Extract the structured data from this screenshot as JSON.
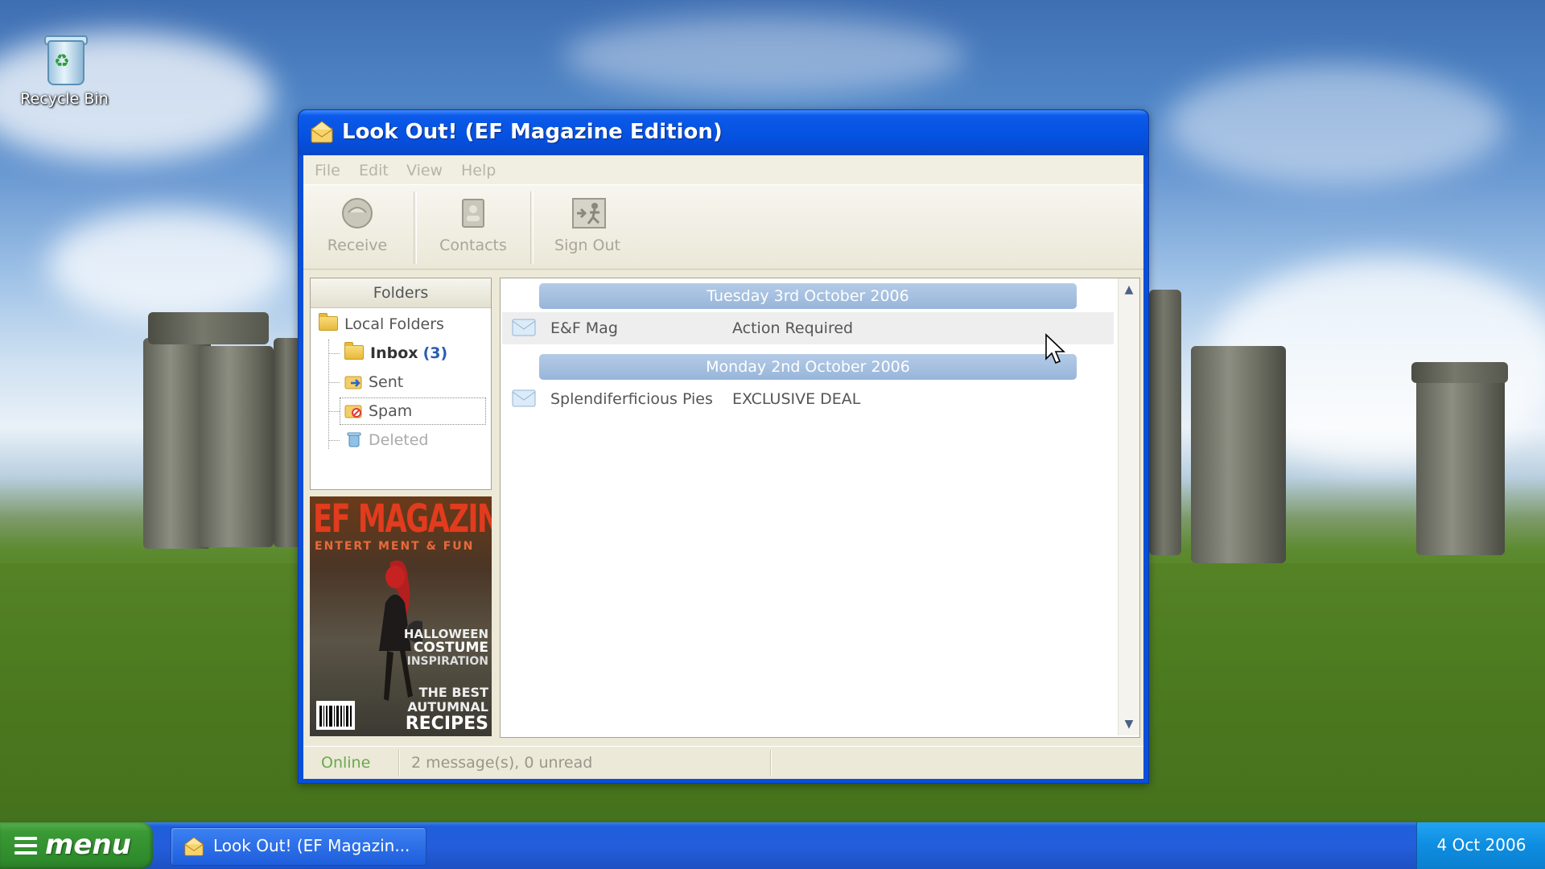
{
  "desktop": {
    "icons": [
      {
        "label": "Recycle Bin",
        "icon": "recycle-bin-icon"
      }
    ]
  },
  "window": {
    "title": "Look Out! (EF Magazine Edition)",
    "menu": [
      "File",
      "Edit",
      "View",
      "Help"
    ],
    "toolbar": [
      {
        "label": "Receive",
        "icon": "receive-icon"
      },
      {
        "label": "Contacts",
        "icon": "contacts-icon"
      },
      {
        "label": "Sign Out",
        "icon": "sign-out-icon"
      }
    ],
    "folders": {
      "header": "Folders",
      "root": "Local Folders",
      "items": [
        {
          "name": "Inbox",
          "count": "(3)"
        },
        {
          "name": "Sent"
        },
        {
          "name": "Spam"
        },
        {
          "name": "Deleted"
        }
      ]
    },
    "ad": {
      "title": "EF MAGAZINE",
      "subtitle": "ENTERT  MENT & FUN",
      "line1": "HALLOWEEN",
      "line2": "COSTUME",
      "line3": "INSPIRATION",
      "line4": "THE BEST",
      "line5": "AUTUMNAL",
      "line6": "RECIPES"
    },
    "messages": {
      "groups": [
        {
          "date": "Tuesday 3rd October 2006",
          "rows": [
            {
              "from": "E&F Mag",
              "subject": "Action Required"
            }
          ]
        },
        {
          "date": "Monday 2nd October 2006",
          "rows": [
            {
              "from": "Splendiferficious Pies",
              "subject": "EXCLUSIVE DEAL"
            }
          ]
        }
      ]
    },
    "status": {
      "connection": "Online",
      "summary": "2 message(s), 0 unread"
    }
  },
  "taskbar": {
    "start_label": "menu",
    "task_label": "Look Out! (EF Magazin...",
    "clock": "4 Oct 2006"
  },
  "colors": {
    "titlebar": "#0551e0",
    "start": "#3a9a35",
    "inbox_count": "#2a5db0",
    "date_bar": "#a6c0e2",
    "online": "#6aa84f"
  }
}
